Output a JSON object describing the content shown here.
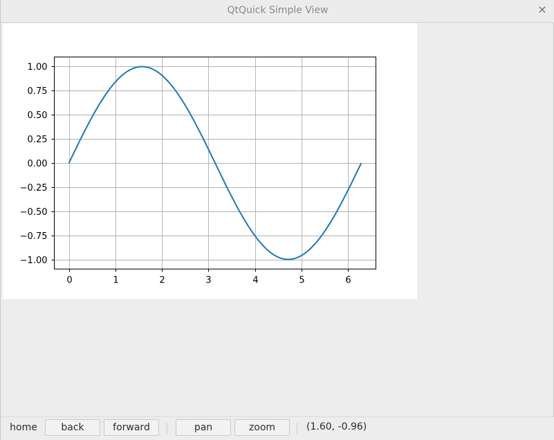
{
  "window": {
    "title": "QtQuick Simple View",
    "close_glyph": "×"
  },
  "toolbar": {
    "home_label": "home",
    "back_label": "back",
    "forward_label": "forward",
    "pan_label": "pan",
    "zoom_label": "zoom",
    "coordinates": "(1.60, -0.96)"
  },
  "colors": {
    "line": "#1f77b4",
    "grid": "#b0b0b0"
  },
  "chart_data": {
    "type": "line",
    "title": "",
    "xlabel": "",
    "ylabel": "",
    "xlim": [
      -0.314,
      6.597
    ],
    "ylim": [
      -1.1,
      1.1
    ],
    "xticks": [
      0,
      1,
      2,
      3,
      4,
      5,
      6
    ],
    "xtick_labels": [
      "0",
      "1",
      "2",
      "3",
      "4",
      "5",
      "6"
    ],
    "yticks": [
      1.0,
      0.75,
      0.5,
      0.25,
      0.0,
      -0.25,
      -0.5,
      -0.75,
      -1.0
    ],
    "ytick_labels": [
      "1.00",
      "0.75",
      "0.50",
      "0.25",
      "0.00",
      "−0.25",
      "−0.50",
      "−0.75",
      "−1.00"
    ],
    "grid": true,
    "series": [
      {
        "x": [
          0,
          0.314,
          0.628,
          0.942,
          1.257,
          1.571,
          1.885,
          2.199,
          2.513,
          2.827,
          3.142,
          3.456,
          3.77,
          4.084,
          4.398,
          4.712,
          5.027,
          5.341,
          5.655,
          5.969,
          6.283
        ],
        "values": [
          0,
          0.309,
          0.588,
          0.809,
          0.951,
          1.0,
          0.951,
          0.809,
          0.588,
          0.309,
          0,
          -0.309,
          -0.588,
          -0.809,
          -0.951,
          -1.0,
          -0.951,
          -0.809,
          -0.588,
          -0.309,
          0
        ]
      }
    ]
  }
}
